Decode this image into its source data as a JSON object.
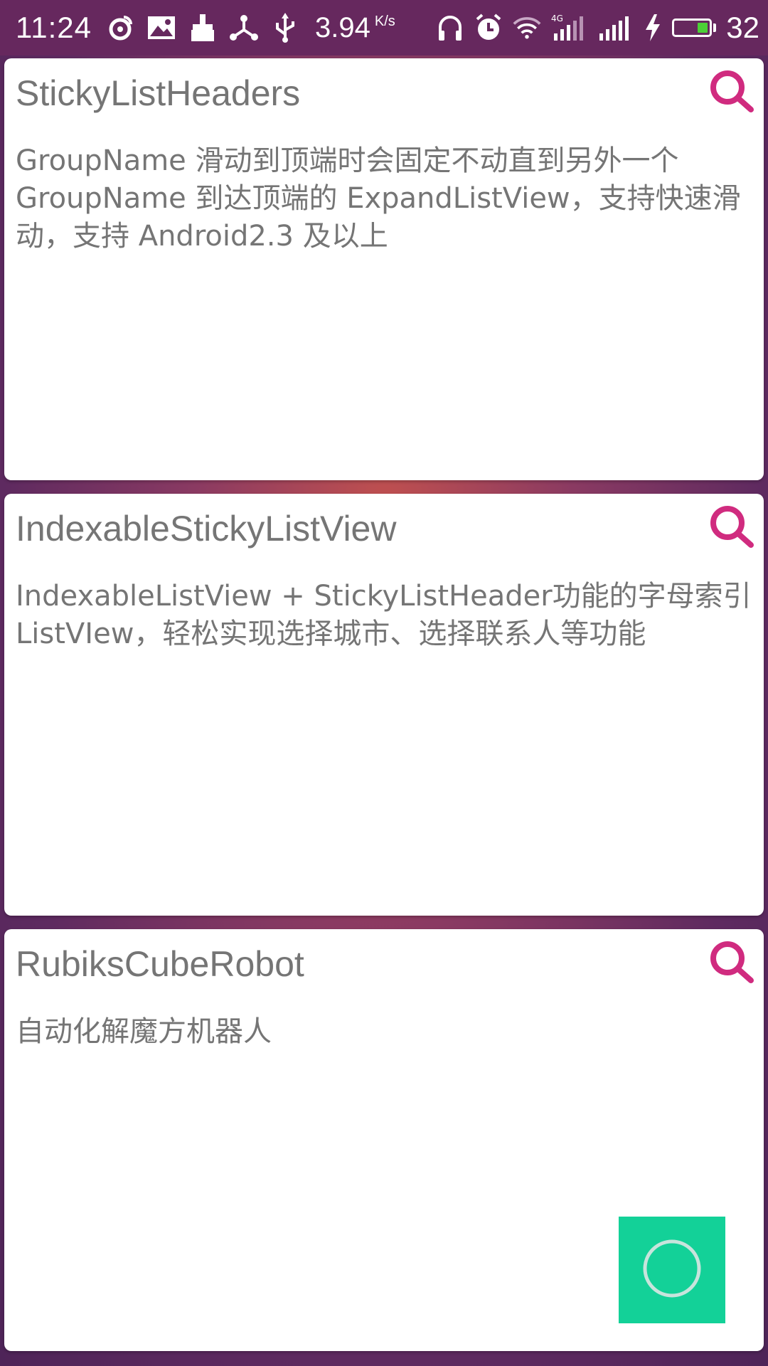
{
  "status_bar": {
    "time": "11:24",
    "net_speed": "3.94",
    "net_speed_unit": "K/s",
    "network_type": "4G",
    "battery_level": "32",
    "battery_fraction": 0.32,
    "battery_fill_color": "#4ccf37",
    "icons_left": [
      "weibo-icon",
      "image-icon",
      "broom-icon",
      "share-icon",
      "usb-icon"
    ],
    "icons_right": [
      "headphones-icon",
      "alarm-icon",
      "wifi-icon",
      "signal-4g-icon",
      "signal-icon",
      "charging-icon",
      "battery-icon"
    ]
  },
  "cards": [
    {
      "title": "StickyListHeaders",
      "description": "GroupName 滑动到顶端时会固定不动直到另外一个GroupName 到达顶端的 ExpandListView，支持快速滑动，支持 Android2.3 及以上",
      "icon": "search-icon"
    },
    {
      "title": "IndexableStickyListView",
      "description": "IndexableListView + StickyListHeader功能的字母索引ListVIew，轻松实现选择城市、选择联系人等功能",
      "icon": "search-icon"
    },
    {
      "title": "RubiksCubeRobot",
      "description": "自动化解魔方机器人",
      "icon": "search-icon"
    }
  ],
  "fab": {
    "icon": "circle-icon",
    "color": "#13d198"
  },
  "colors": {
    "status_bar_bg": "#66285e",
    "accent": "#d02b7f",
    "text_secondary": "#757575"
  }
}
